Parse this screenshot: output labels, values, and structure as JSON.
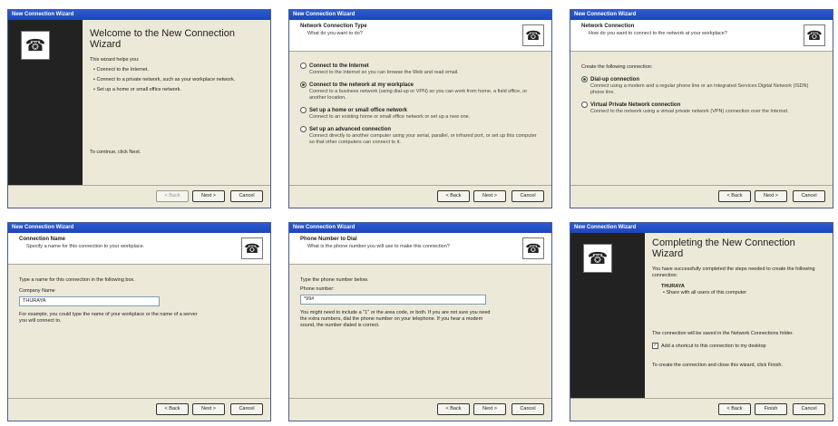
{
  "windows": [
    {
      "title": "New Connection Wizard",
      "welcome_title": "Welcome to the New Connection Wizard",
      "intro": "This wizard helps you:",
      "bullets": [
        "Connect to the Internet.",
        "Connect to a private network, such as your workplace network.",
        "Set up a home or small office network."
      ],
      "continue": "To continue, click Next.",
      "buttons": {
        "back": "< Back",
        "next": "Next >",
        "cancel": "Cancel"
      }
    },
    {
      "title": "New Connection Wizard",
      "hdr_title": "Network Connection Type",
      "hdr_sub": "What do you want to do?",
      "options": [
        {
          "label": "Connect to the Internet",
          "desc": "Connect to the Internet so you can browse the Web and read email."
        },
        {
          "label": "Connect to the network at my workplace",
          "desc": "Connect to a business network (using dial-up or VPN) so you can work from home, a field office, or another location."
        },
        {
          "label": "Set up a home or small office network",
          "desc": "Connect to an existing home or small office network or set up a new one."
        },
        {
          "label": "Set up an advanced connection",
          "desc": "Connect directly to another computer using your serial, parallel, or infrared port, or set up this computer so that other computers can connect to it."
        }
      ],
      "buttons": {
        "back": "< Back",
        "next": "Next >",
        "cancel": "Cancel"
      }
    },
    {
      "title": "New Connection Wizard",
      "hdr_title": "Network Connection",
      "hdr_sub": "How do you want to connect to the network at your workplace?",
      "lead": "Create the following connection:",
      "options": [
        {
          "label": "Dial-up connection",
          "desc": "Connect using a modem and a regular phone line or an Integrated Services Digital Network (ISDN) phone line."
        },
        {
          "label": "Virtual Private Network connection",
          "desc": "Connect to the network using a virtual private network (VPN) connection over the Internet."
        }
      ],
      "buttons": {
        "back": "< Back",
        "next": "Next >",
        "cancel": "Cancel"
      }
    },
    {
      "title": "New Connection Wizard",
      "hdr_title": "Connection Name",
      "hdr_sub": "Specify a name for this connection to your workplace.",
      "lead": "Type a name for this connection in the following box.",
      "field_label": "Company Name",
      "field_value": "THURAYA",
      "hint": "For example, you could type the name of your workplace or the name of a server you will connect to.",
      "buttons": {
        "back": "< Back",
        "next": "Next >",
        "cancel": "Cancel"
      }
    },
    {
      "title": "New Connection Wizard",
      "hdr_title": "Phone Number to Dial",
      "hdr_sub": "What is the phone number you will use to make this connection?",
      "lead": "Type the phone number below.",
      "field_label": "Phone number:",
      "field_value": "*99#",
      "hint": "You might need to include a \"1\" or the area code, or both. If you are not sure you need the extra numbers, dial the phone number on your telephone. If you hear a modem sound, the number dialed is correct.",
      "buttons": {
        "back": "< Back",
        "next": "Next >",
        "cancel": "Cancel"
      }
    },
    {
      "title": "New Connection Wizard",
      "welcome_title": "Completing the New Connection Wizard",
      "intro": "You have successfully completed the steps needed to create the following connection:",
      "conn_name": "THURAYA",
      "conn_detail": "• Share with all users of this computer",
      "saved": "The connection will be saved in the Network Connections folder.",
      "shortcut": "Add a shortcut to this connection to my desktop",
      "finish_hint": "To create the connection and close this wizard, click Finish.",
      "buttons": {
        "back": "< Back",
        "next": "Finish",
        "cancel": "Cancel"
      }
    }
  ]
}
